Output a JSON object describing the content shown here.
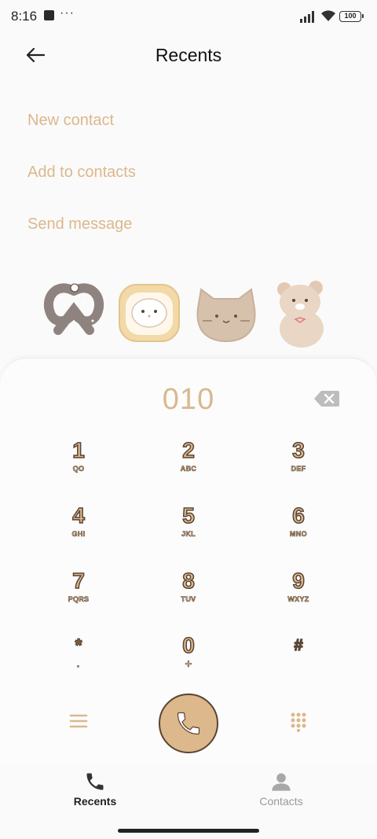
{
  "status_bar": {
    "time": "8:16",
    "dots": "···",
    "battery": "100"
  },
  "header": {
    "title": "Recents",
    "back_icon": "arrow-left-icon"
  },
  "actions": [
    {
      "label": "New contact"
    },
    {
      "label": "Add to contacts"
    },
    {
      "label": "Send message"
    }
  ],
  "stickers": [
    "pretzel-sticker",
    "bunny-toast-sticker",
    "cat-sticker",
    "bear-sticker"
  ],
  "dialer": {
    "number": "010",
    "backspace_icon": "backspace-icon",
    "keys": [
      {
        "digit": "1",
        "letters": "QO"
      },
      {
        "digit": "2",
        "letters": "ABC"
      },
      {
        "digit": "3",
        "letters": "DEF"
      },
      {
        "digit": "4",
        "letters": "GHI"
      },
      {
        "digit": "5",
        "letters": "JKL"
      },
      {
        "digit": "6",
        "letters": "MNO"
      },
      {
        "digit": "7",
        "letters": "PQRS"
      },
      {
        "digit": "8",
        "letters": "TUV"
      },
      {
        "digit": "9",
        "letters": "WXYZ"
      },
      {
        "digit": "*",
        "letters": "·"
      },
      {
        "digit": "0",
        "letters": "+"
      },
      {
        "digit": "#",
        "letters": ""
      }
    ],
    "call_icon": "phone-icon"
  },
  "bottom_nav": {
    "tabs": [
      {
        "label": "Recents",
        "icon": "phone-icon",
        "active": true
      },
      {
        "label": "Contacts",
        "icon": "person-icon",
        "active": false
      }
    ]
  },
  "colors": {
    "accent": "#dcb88c",
    "outline": "#5a4433",
    "background": "#fafafa"
  }
}
